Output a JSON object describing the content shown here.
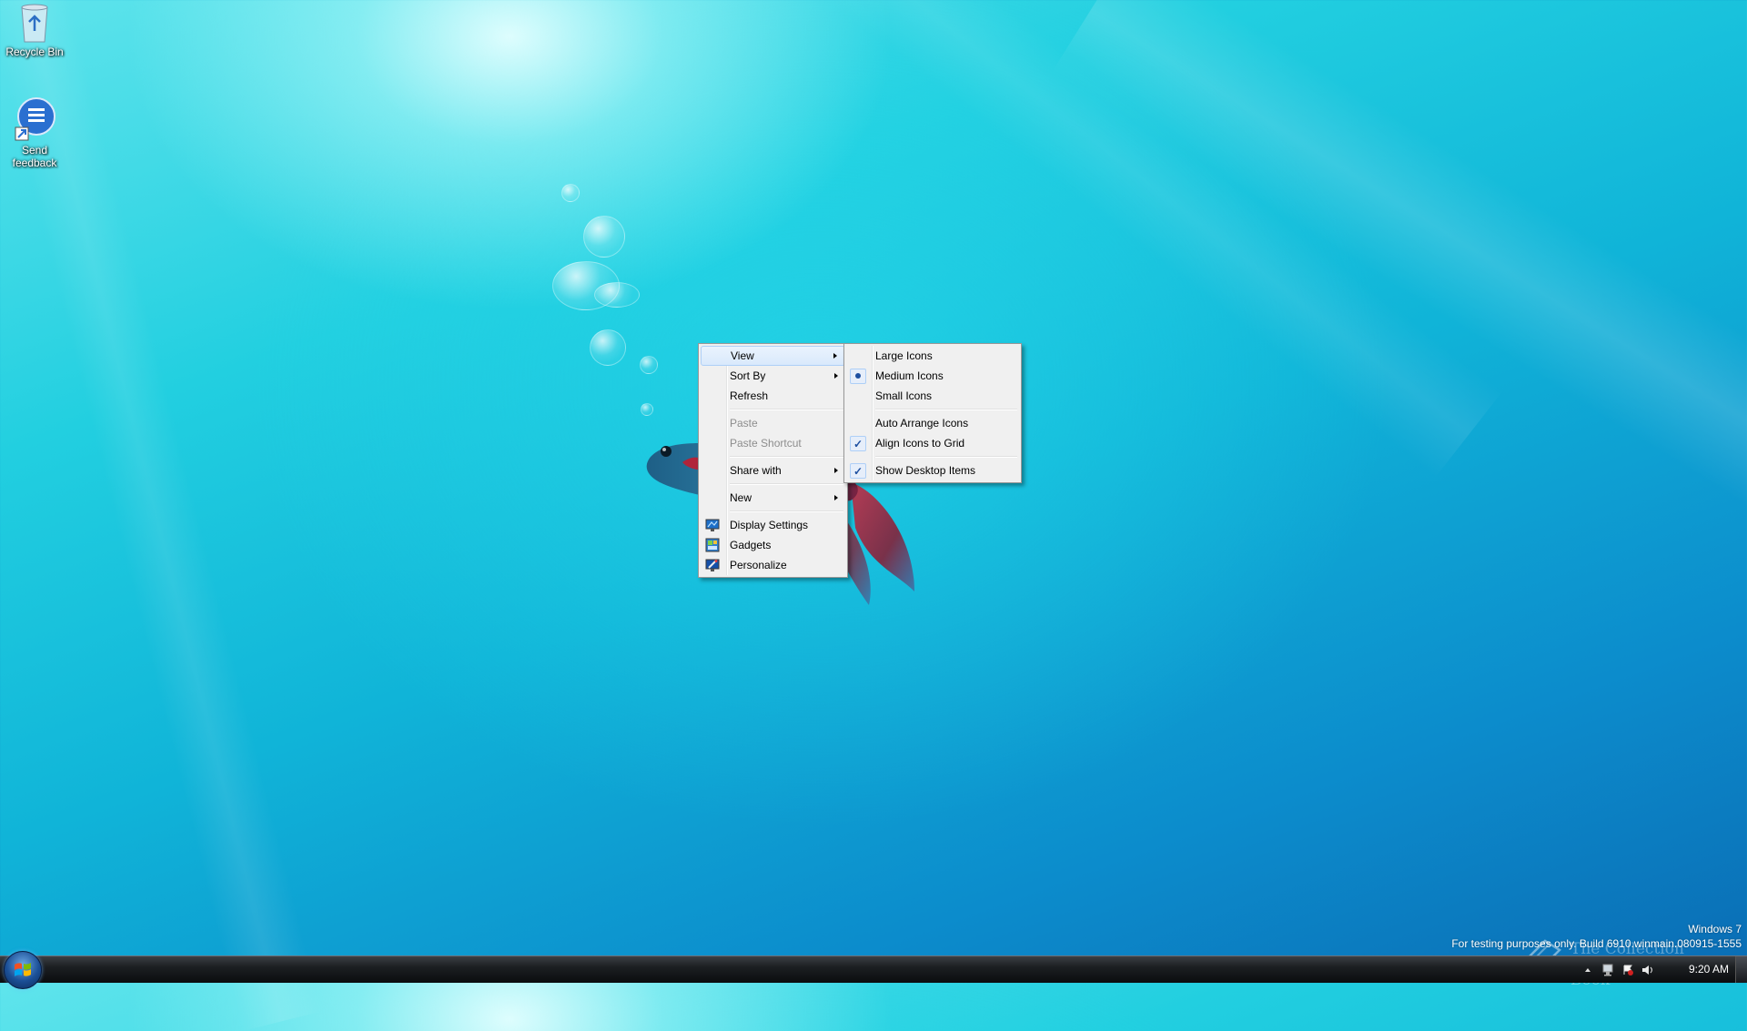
{
  "desktop": {
    "icons": [
      {
        "label": "Recycle Bin",
        "icon": "recycle-bin-icon"
      },
      {
        "label": "Send feedback",
        "icon": "send-feedback-icon"
      }
    ]
  },
  "context_menu": {
    "items": [
      {
        "label": "View",
        "submenu": true,
        "highlighted": true
      },
      {
        "label": "Sort By",
        "submenu": true
      },
      {
        "label": "Refresh"
      },
      {
        "label": "Paste",
        "disabled": true
      },
      {
        "label": "Paste Shortcut",
        "disabled": true
      },
      {
        "label": "Share with",
        "submenu": true
      },
      {
        "label": "New",
        "submenu": true
      },
      {
        "label": "Display Settings",
        "icon": "display-settings-icon"
      },
      {
        "label": "Gadgets",
        "icon": "gadgets-icon"
      },
      {
        "label": "Personalize",
        "icon": "personalize-icon"
      }
    ]
  },
  "view_submenu": {
    "items": [
      {
        "label": "Large Icons"
      },
      {
        "label": "Medium Icons",
        "selected": true
      },
      {
        "label": "Small Icons"
      },
      {
        "label": "Auto Arrange Icons"
      },
      {
        "label": "Align Icons to Grid",
        "checked": true
      },
      {
        "label": "Show Desktop Items",
        "checked": true
      }
    ],
    "check_glyph": "✓"
  },
  "watermark": {
    "line1": "Windows 7",
    "line2": "For testing purposes only. Build 6910.winmain.080915-1555",
    "overlay_logo": "The Collection Book"
  },
  "taskbar": {
    "clock": "9:20 AM",
    "tray_icons": [
      "show-hidden-icons-arrow",
      "network-icon",
      "action-center-icon",
      "volume-icon"
    ]
  },
  "colors": {
    "menu_bg": "#f0f0f0",
    "menu_highlight": "#d9e9fc",
    "menu_highlight_border": "#aecff7",
    "disabled_text": "#8d8d8d",
    "taskbar": "#1c1f22",
    "wallpaper_accent": "#22cfe0"
  }
}
